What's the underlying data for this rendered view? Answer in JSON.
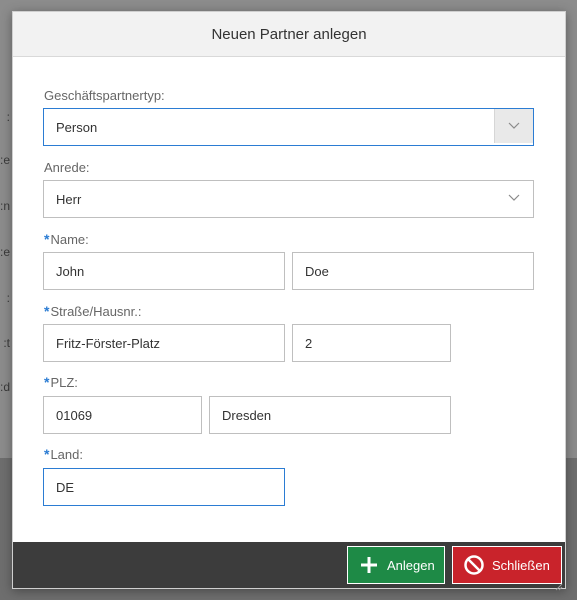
{
  "dialog": {
    "title": "Neuen Partner anlegen"
  },
  "background_labels": [
    ":",
    "e:",
    "n:",
    "e:",
    ":",
    "t:",
    "d:"
  ],
  "form": {
    "partner_type": {
      "label": "Geschäftspartnertyp:",
      "value": "Person"
    },
    "salutation": {
      "label": "Anrede:",
      "value": "Herr"
    },
    "name": {
      "label": "Name:",
      "first": "John",
      "last": "Doe"
    },
    "street": {
      "label": "Straße/Hausnr.:",
      "street": "Fritz-Förster-Platz",
      "number": "2"
    },
    "zip": {
      "label": "PLZ:",
      "zip": "01069",
      "city": "Dresden"
    },
    "country": {
      "label": "Land:",
      "value": "DE"
    },
    "required_marker": "*"
  },
  "footer": {
    "create_label": "Anlegen",
    "close_label": "Schließen"
  },
  "colors": {
    "accent": "#2b7cd3",
    "create": "#1e8a46",
    "close": "#c9232b",
    "footer": "#3c3c3c"
  }
}
